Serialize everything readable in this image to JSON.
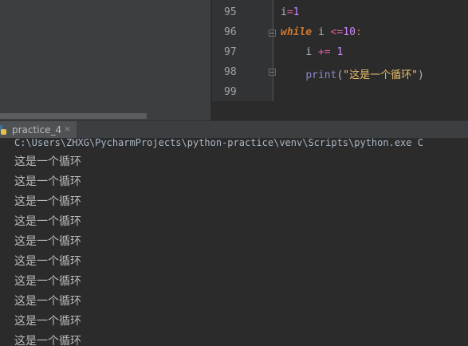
{
  "editor": {
    "lines": [
      {
        "number": "95",
        "text": "i=1"
      },
      {
        "number": "96",
        "text": "while i <=10:"
      },
      {
        "number": "97",
        "text": "    i += 1"
      },
      {
        "number": "98",
        "text": "    print(\"这是一个循环\")"
      },
      {
        "number": "99",
        "text": ""
      }
    ],
    "tokens": {
      "l95_var": "i",
      "l95_op": "=",
      "l95_num": "1",
      "l96_kw": "while",
      "l96_var": "i",
      "l96_op": "<=",
      "l96_num": "10",
      "l96_colon": ":",
      "l97_var": "i",
      "l97_op": "+=",
      "l97_num": "1",
      "l98_fn": "print",
      "l98_open": "(",
      "l98_str": "\"这是一个循环\"",
      "l98_close": ")"
    }
  },
  "run": {
    "tab_label": "practice_4",
    "tab_close": "×",
    "icon": "python-icon",
    "command": "C:\\Users\\ZHXG\\PycharmProjects\\python-practice\\venv\\Scripts\\python.exe C",
    "output": [
      "这是一个循环",
      "这是一个循环",
      "这是一个循环",
      "这是一个循环",
      "这是一个循环",
      "这是一个循环",
      "这是一个循环",
      "这是一个循环",
      "这是一个循环",
      "这是一个循环"
    ]
  }
}
